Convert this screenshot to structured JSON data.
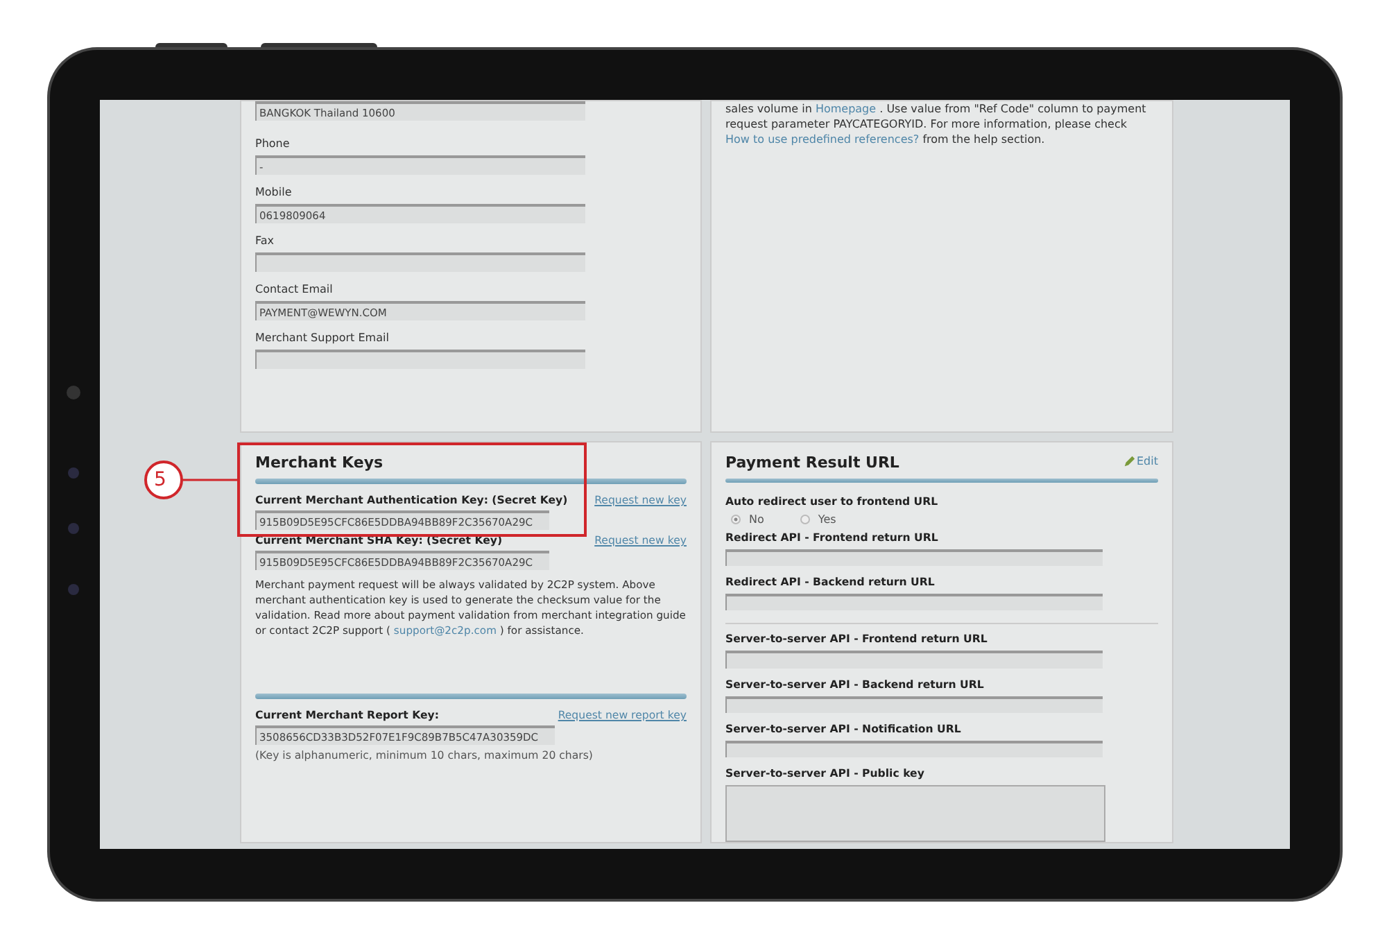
{
  "profile": {
    "address_value": "BANGKOK Thailand 10600",
    "fields": [
      {
        "label": "Phone",
        "value": "-"
      },
      {
        "label": "Mobile",
        "value": "0619809064"
      },
      {
        "label": "Fax"
      },
      {
        "label": "Contact Email",
        "value": "PAYMENT@WEWYN.COM"
      },
      {
        "label": "Merchant Support Email"
      }
    ]
  },
  "references_note": [
    {
      "kind": "text",
      "text": "sales volume in "
    },
    {
      "kind": "link",
      "text": "Homepage"
    },
    {
      "kind": "text",
      "text": " . Use value from \"Ref Code\" column to payment request parameter PAYCATEGORYID. For more information, please check "
    },
    {
      "kind": "link",
      "text": "How to use predefined references?"
    },
    {
      "kind": "text",
      "text": " from the help section."
    }
  ],
  "merchant_keys": {
    "title": "Merchant Keys",
    "callout": "5",
    "keys": [
      {
        "label": "Current Merchant Authentication Key: (Secret Key)",
        "link": "Request new key",
        "value": "915B09D5E95CFC86E5DDBA94BB89F2C35670A29C"
      },
      {
        "label": "Current Merchant SHA Key: (Secret Key)",
        "link": "Request new key",
        "value": "915B09D5E95CFC86E5DDBA94BB89F2C35670A29C"
      }
    ],
    "note": [
      {
        "kind": "text",
        "text": "Merchant payment request will be always validated by 2C2P system. Above merchant authentication key is used to generate the checksum value for the validation. Read more about payment validation from merchant integration guide or contact 2C2P support ( "
      },
      {
        "kind": "link",
        "text": "support@2c2p.com"
      },
      {
        "kind": "text",
        "text": " ) for assistance."
      }
    ],
    "report_key": {
      "label": "Current Merchant Report Key:",
      "link": "Request new report key",
      "value": "3508656CD33B3D52F07E1F9C89B7B5C47A30359DC",
      "hint": "(Key is alphanumeric, minimum 10 chars, maximum 20 chars)"
    }
  },
  "payment_result": {
    "title": "Payment Result URL",
    "edit": "Edit",
    "rows": [
      {
        "kind": "radio",
        "label": "Auto redirect user to frontend URL",
        "options": [
          {
            "label": "No",
            "selected": true
          },
          {
            "label": "Yes",
            "selected": false
          }
        ]
      },
      {
        "kind": "field",
        "label": "Redirect API - Frontend return URL"
      },
      {
        "kind": "field",
        "label": "Redirect API - Backend return URL"
      },
      {
        "kind": "divider"
      },
      {
        "kind": "field",
        "label": "Server-to-server API - Frontend return URL"
      },
      {
        "kind": "field",
        "label": "Server-to-server API - Backend return URL"
      },
      {
        "kind": "field",
        "label": "Server-to-server API - Notification URL"
      },
      {
        "kind": "textarea",
        "label": "Server-to-server API - Public key"
      }
    ]
  }
}
